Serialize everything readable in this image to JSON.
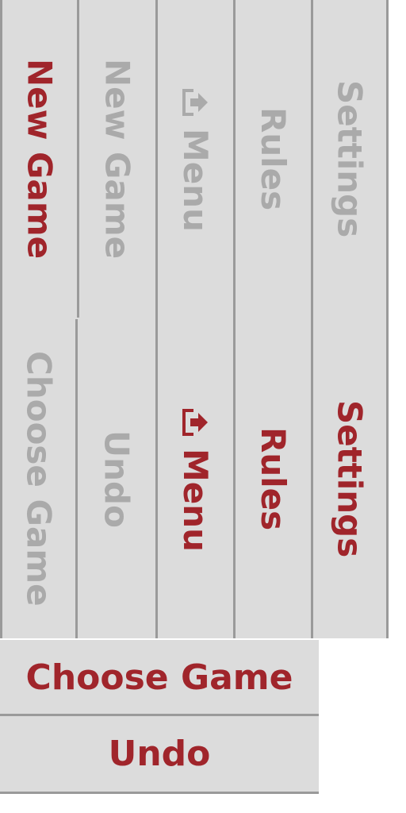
{
  "colors": {
    "accent": "#a0252b",
    "ghost": "#aaaaaa",
    "panel": "#dcdcdc",
    "divider": "#9a9a9a"
  },
  "vertical_menu": {
    "top_row": {
      "new_game": "New Game",
      "new_game_ghost": "New Game",
      "menu": "Menu",
      "rules": "Rules",
      "settings": "Settings"
    },
    "bottom_row": {
      "choose_game": "Choose Game",
      "undo": "Undo",
      "menu": "Menu",
      "rules": "Rules",
      "settings": "Settings"
    },
    "menu_icon": "upload-tray-icon"
  },
  "horizontal_menu": {
    "choose_game": "Choose Game",
    "undo": "Undo"
  }
}
